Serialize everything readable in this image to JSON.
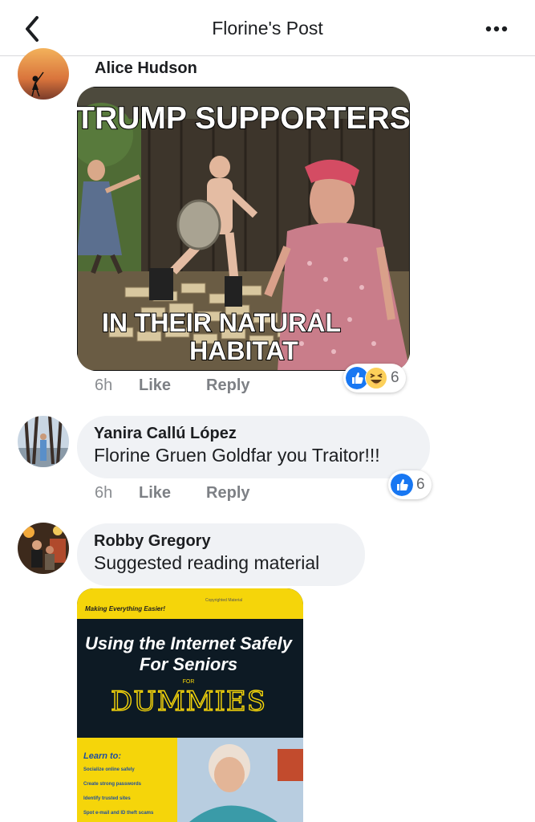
{
  "header": {
    "title": "Florine's Post"
  },
  "comments": [
    {
      "author": "Alice Hudson",
      "image": {
        "top_text": "TRUMP SUPPORTERS",
        "bottom_text_1": "IN THEIR NATURAL",
        "bottom_text_2": "HABITAT"
      },
      "time": "6h",
      "like_label": "Like",
      "reply_label": "Reply",
      "reaction_count": "6",
      "reactions": [
        "like-icon",
        "haha-icon"
      ]
    },
    {
      "author": "Yanira Callú López",
      "text": "Florine Gruen Goldfar you Traitor!!!",
      "time": "6h",
      "like_label": "Like",
      "reply_label": "Reply",
      "reaction_count": "6",
      "reactions": [
        "like-icon"
      ]
    },
    {
      "author": "Robby Gregory",
      "text": "Suggested reading material",
      "image": {
        "banner": "Making Everything Easier!",
        "banner_small": "Copyrighted Material",
        "title_1": "Using the Internet Safely",
        "title_2": "For Seniors",
        "for": "FOR",
        "dummies": "DUMMIES",
        "learn_to": "Learn to:",
        "bullets": [
          "Socialize online safely",
          "Create strong passwords",
          "Identify trusted sites",
          "Spot e-mail and ID theft scams"
        ]
      }
    }
  ],
  "colors": {
    "facebook_blue": "#1877f2",
    "bubble_bg": "#f0f2f5",
    "meta_gray": "#8a8d91",
    "dummies_yellow": "#f5d50a"
  }
}
